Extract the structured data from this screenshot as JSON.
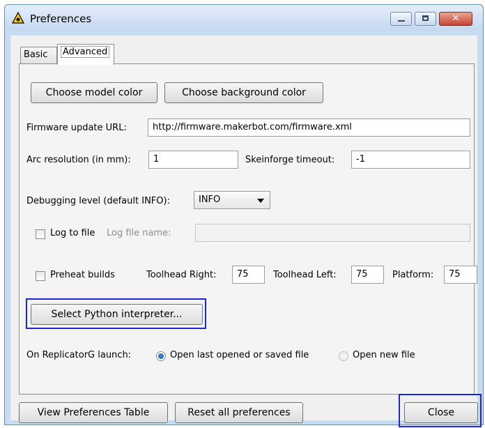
{
  "window": {
    "title": "Preferences",
    "close_glyph": "✕"
  },
  "tabs": [
    {
      "label": "Basic"
    },
    {
      "label": "Advanced"
    }
  ],
  "buttons": {
    "model_color": "Choose model color",
    "background_color": "Choose background color",
    "python": "Select Python interpreter...",
    "view_table": "View Preferences Table",
    "reset": "Reset all preferences",
    "close": "Close"
  },
  "firmware": {
    "label": "Firmware update URL:",
    "value": "http://firmware.makerbot.com/firmware.xml"
  },
  "arc": {
    "label": "Arc resolution (in mm):",
    "value": "1"
  },
  "skeinforge": {
    "label": "Skeinforge timeout:",
    "value": "-1"
  },
  "debugging": {
    "label": "Debugging level (default INFO):",
    "selected": "INFO"
  },
  "log": {
    "checkbox_label": "Log to file",
    "name_label": "Log file name:",
    "name_value": ""
  },
  "preheat": {
    "checkbox_label": "Preheat builds",
    "right_label": "Toolhead Right:",
    "right_value": "75",
    "left_label": "Toolhead Left:",
    "left_value": "75",
    "platform_label": "Platform:",
    "platform_value": "75"
  },
  "launch": {
    "label": "On ReplicatorG launch:",
    "option1": "Open last opened or saved file",
    "option2": "Open new file"
  },
  "icons": {
    "app": "warning-triangle-icon"
  },
  "colors": {
    "highlight": "#1c27d4",
    "titlebar": "#c4d8ef"
  }
}
